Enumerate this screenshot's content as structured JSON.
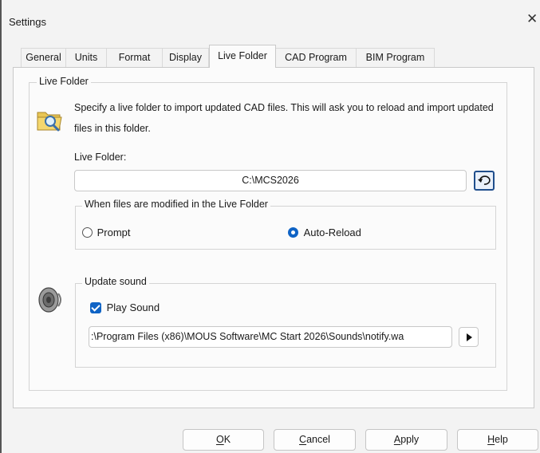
{
  "window": {
    "title": "Settings",
    "close_symbol": "✕"
  },
  "tabs": [
    {
      "label": "General",
      "active": false
    },
    {
      "label": "Units",
      "active": false
    },
    {
      "label": "Format",
      "active": false
    },
    {
      "label": "Display",
      "active": false
    },
    {
      "label": "Live Folder",
      "active": true
    },
    {
      "label": "CAD Program",
      "active": false
    },
    {
      "label": "BIM Program",
      "active": false
    }
  ],
  "live_folder": {
    "group_title": "Live Folder",
    "description": "Specify a live folder to import updated CAD files. This will ask you to reload and import updated files in this folder.",
    "folder_label": "Live Folder:",
    "folder_value": "C:\\MCS2026",
    "icon": "folder-search-icon",
    "reset_icon": "undo-icon"
  },
  "modified_group": {
    "title": "When files are modified in the Live Folder",
    "option_prompt": "Prompt",
    "option_auto": "Auto-Reload",
    "selected": "Auto-Reload"
  },
  "sound_group": {
    "title": "Update sound",
    "play_sound_label": "Play Sound",
    "play_sound_checked": true,
    "sound_path": ":\\Program Files (x86)\\MOUS Software\\MC Start 2026\\Sounds\\notify.wa",
    "icon": "speaker-icon",
    "play_icon": "play-icon"
  },
  "buttons": {
    "ok": {
      "mnemonic": "O",
      "rest": "K"
    },
    "cancel": {
      "mnemonic": "C",
      "rest": "ancel"
    },
    "apply": {
      "mnemonic": "A",
      "rest": "pply"
    },
    "help": {
      "mnemonic": "H",
      "rest": "elp"
    }
  },
  "colors": {
    "accent": "#0f63c5",
    "background": "#f3f3f3",
    "panel": "#fbfbfb"
  }
}
